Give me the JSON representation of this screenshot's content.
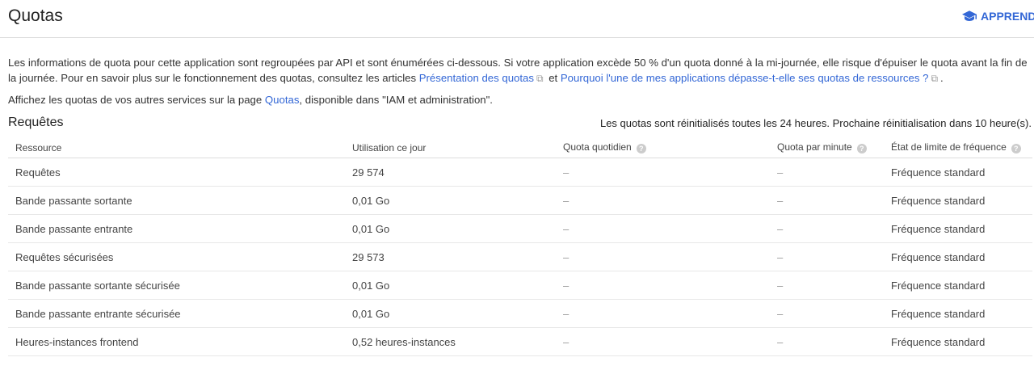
{
  "header": {
    "title": "Quotas",
    "learn_label": "APPRENDRE"
  },
  "intro": {
    "p1_text1": "Les informations de quota pour cette application sont regroupées par API et sont énumérées ci-dessous. Si votre application excède 50 % d'un quota donné à la mi-journée, elle risque d'épuiser le quota avant la fin de la journée. Pour en savoir plus sur le fonctionnement des quotas, consultez les articles ",
    "link1": "Présentation des quotas",
    "and": " et ",
    "link2": "Pourquoi l'une de mes applications dépasse-t-elle ses quotas de ressources ?",
    "p1_end": ".",
    "p2_text1": "Affichez les quotas de vos autres services sur la page ",
    "p2_link": "Quotas",
    "p2_text2": ", disponible dans \"IAM et administration\"."
  },
  "section": {
    "title": "Requêtes",
    "reset_note": "Les quotas sont réinitialisés toutes les 24 heures. Prochaine réinitialisation dans 10 heure(s)."
  },
  "table": {
    "headers": [
      "Ressource",
      "Utilisation ce jour",
      "Quota quotidien",
      "Quota par minute",
      "État de limite de fréquence"
    ],
    "rows": [
      [
        "Requêtes",
        "29 574",
        "–",
        "–",
        "Fréquence standard"
      ],
      [
        "Bande passante sortante",
        "0,01 Go",
        "–",
        "–",
        "Fréquence standard"
      ],
      [
        "Bande passante entrante",
        "0,01 Go",
        "–",
        "–",
        "Fréquence standard"
      ],
      [
        "Requêtes sécurisées",
        "29 573",
        "–",
        "–",
        "Fréquence standard"
      ],
      [
        "Bande passante sortante sécurisée",
        "0,01 Go",
        "–",
        "–",
        "Fréquence standard"
      ],
      [
        "Bande passante entrante sécurisée",
        "0,01 Go",
        "–",
        "–",
        "Fréquence standard"
      ],
      [
        "Heures-instances frontend",
        "0,52 heures-instances",
        "–",
        "–",
        "Fréquence standard"
      ]
    ]
  }
}
